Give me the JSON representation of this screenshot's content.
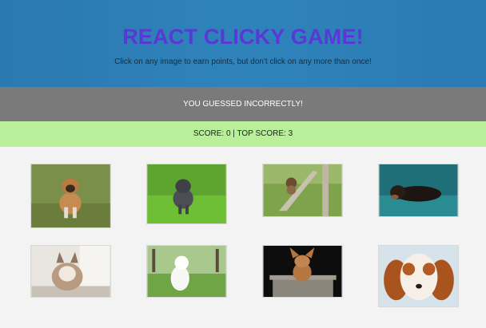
{
  "header": {
    "title": "REACT CLICKY GAME!",
    "subtitle": "Click on any image to earn points, but don't click on any more than once!"
  },
  "status": {
    "message": "YOU GUESSED INCORRECTLY!"
  },
  "score": {
    "text": "SCORE: 0 | TOP SCORE: 3"
  },
  "colors": {
    "header_bg": "#2f83bb",
    "title": "#5a37d6",
    "status_bg": "#7a7a7a",
    "score_bg": "#b7ef9b",
    "page_bg": "#f3f3f3"
  },
  "images": [
    {
      "name": "puppy-boxer-on-grass"
    },
    {
      "name": "puppy-gray-on-grass"
    },
    {
      "name": "puppy-on-tree-branch"
    },
    {
      "name": "dog-lying-on-teal"
    },
    {
      "name": "husky-puppy-indoors"
    },
    {
      "name": "white-spitz-on-grass"
    },
    {
      "name": "chihuahua-on-stump"
    },
    {
      "name": "cavalier-spaniel-closeup"
    }
  ]
}
